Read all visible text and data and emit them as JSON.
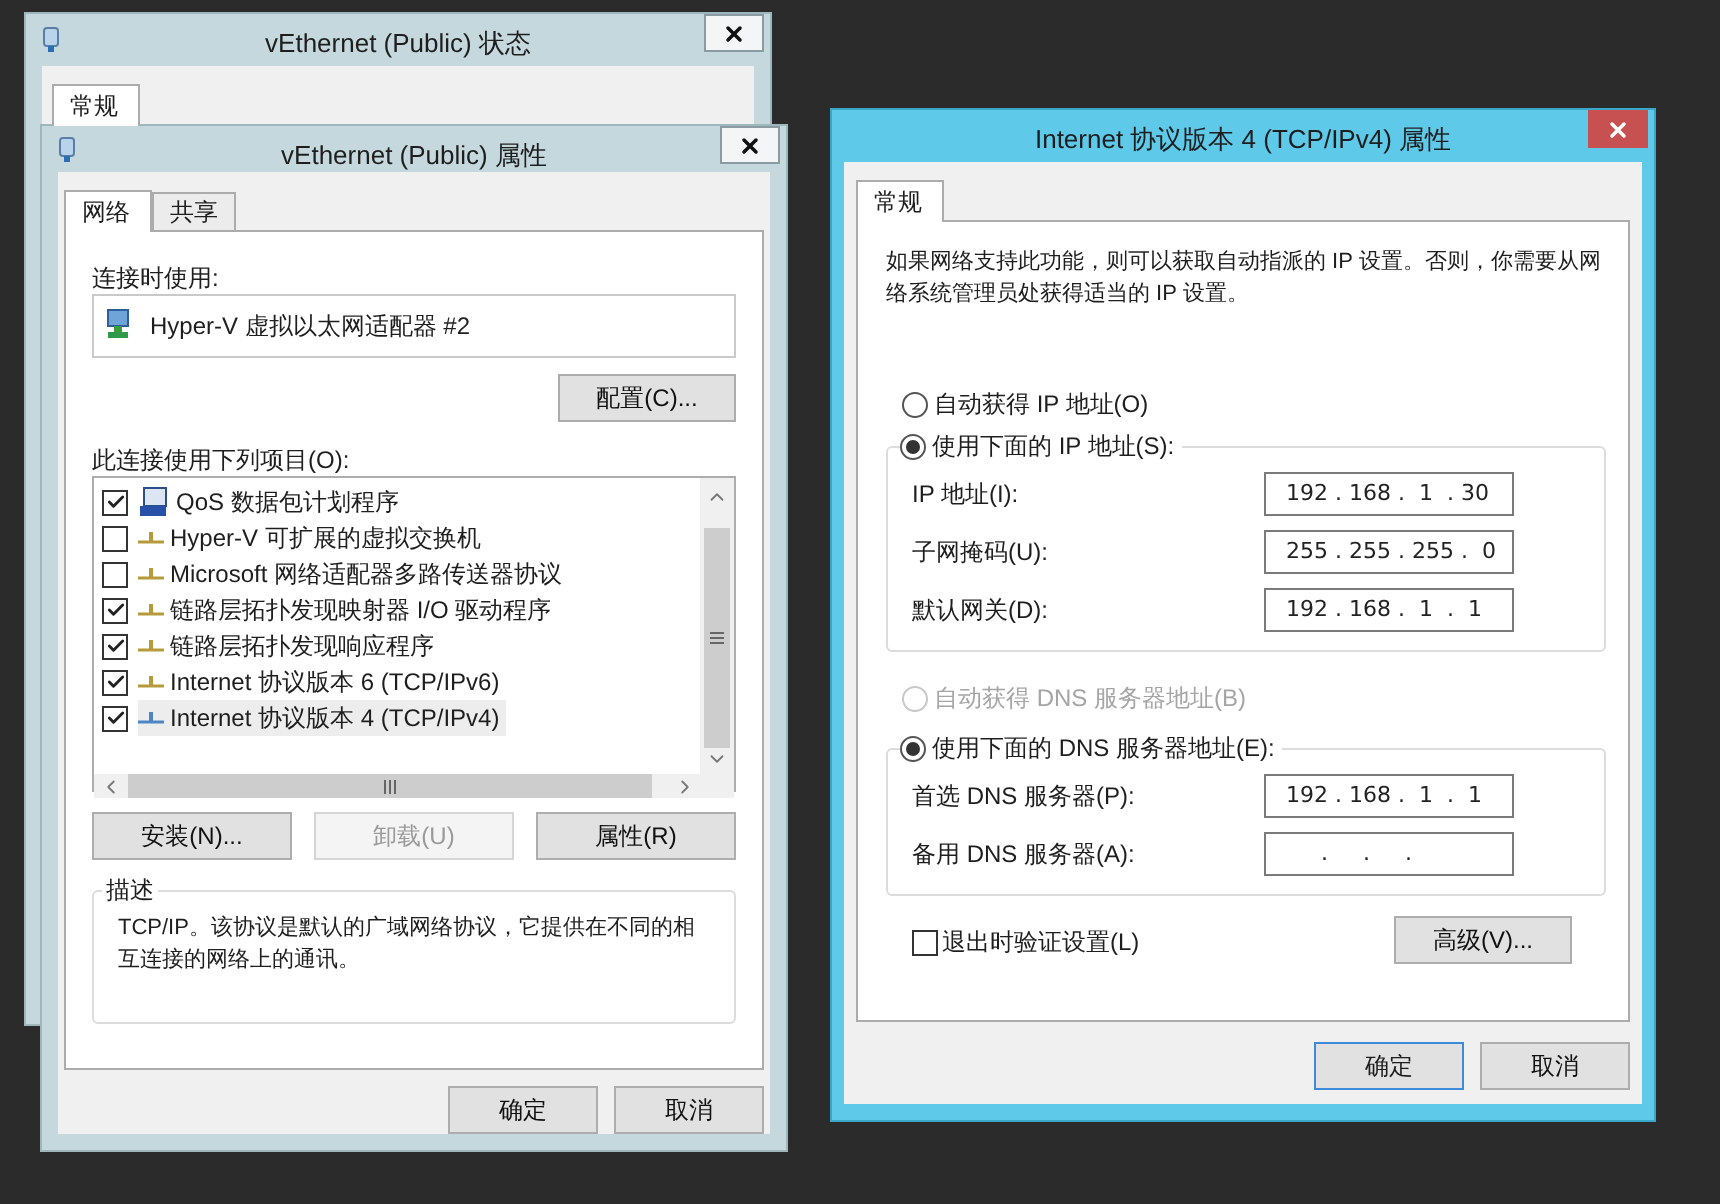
{
  "status_window": {
    "title": "vEthernet (Public) 状态",
    "tabs": [
      {
        "label": "常规",
        "selected": true
      }
    ]
  },
  "properties_window": {
    "title": "vEthernet (Public) 属性",
    "tabs": [
      {
        "label": "网络",
        "selected": true
      },
      {
        "label": "共享",
        "selected": false
      }
    ],
    "connect_using_label": "连接时使用:",
    "adapter": "Hyper-V 虚拟以太网适配器 #2",
    "configure_button": "配置(C)...",
    "items_label": "此连接使用下列项目(O):",
    "items": [
      {
        "label": "QoS 数据包计划程序",
        "checked": true,
        "selected": false,
        "kind": "service"
      },
      {
        "label": "Hyper-V 可扩展的虚拟交换机",
        "checked": false,
        "selected": false,
        "kind": "protocol"
      },
      {
        "label": "Microsoft 网络适配器多路传送器协议",
        "checked": false,
        "selected": false,
        "kind": "protocol"
      },
      {
        "label": "链路层拓扑发现映射器 I/O 驱动程序",
        "checked": true,
        "selected": false,
        "kind": "protocol"
      },
      {
        "label": "链路层拓扑发现响应程序",
        "checked": true,
        "selected": false,
        "kind": "protocol"
      },
      {
        "label": "Internet 协议版本 6 (TCP/IPv6)",
        "checked": true,
        "selected": false,
        "kind": "protocol"
      },
      {
        "label": "Internet 协议版本 4 (TCP/IPv4)",
        "checked": true,
        "selected": true,
        "kind": "protocol"
      }
    ],
    "item_buttons": [
      {
        "label": "安装(N)...",
        "disabled": false
      },
      {
        "label": "卸载(U)",
        "disabled": true
      },
      {
        "label": "属性(R)",
        "disabled": false
      }
    ],
    "description_label": "描述",
    "description": "TCP/IP。该协议是默认的广域网络协议，它提供在不同的相互连接的网络上的通讯。",
    "buttons": [
      {
        "label": "确定"
      },
      {
        "label": "取消"
      }
    ]
  },
  "ipv4_window": {
    "title": "Internet 协议版本 4 (TCP/IPv4) 属性",
    "tabs": [
      {
        "label": "常规",
        "selected": true
      }
    ],
    "intro": "如果网络支持此功能，则可以获取自动指派的 IP 设置。否则，你需要从网络系统管理员处获得适当的 IP 设置。",
    "ip_modes": [
      {
        "label": "自动获得 IP 地址(O)",
        "selected": false,
        "disabled": false
      },
      {
        "label": "使用下面的 IP 地址(S):",
        "selected": true,
        "disabled": false
      }
    ],
    "ip_fields": [
      {
        "label": "IP 地址(I):",
        "value": "192 . 168 .  1  . 30"
      },
      {
        "label": "子网掩码(U):",
        "value": "255 . 255 . 255 .  0"
      },
      {
        "label": "默认网关(D):",
        "value": "192 . 168 .  1  .  1"
      }
    ],
    "dns_modes": [
      {
        "label": "自动获得 DNS 服务器地址(B)",
        "selected": false,
        "disabled": true
      },
      {
        "label": "使用下面的 DNS 服务器地址(E):",
        "selected": true,
        "disabled": false
      }
    ],
    "dns_fields": [
      {
        "label": "首选 DNS 服务器(P):",
        "value": "192 . 168 .  1  .  1"
      },
      {
        "label": "备用 DNS 服务器(A):",
        "value": "     .     .     ."
      }
    ],
    "validate": {
      "label": "退出时验证设置(L)",
      "checked": false
    },
    "advanced_button": "高级(V)...",
    "buttons": [
      {
        "label": "确定",
        "default": true
      },
      {
        "label": "取消",
        "default": false
      }
    ]
  }
}
